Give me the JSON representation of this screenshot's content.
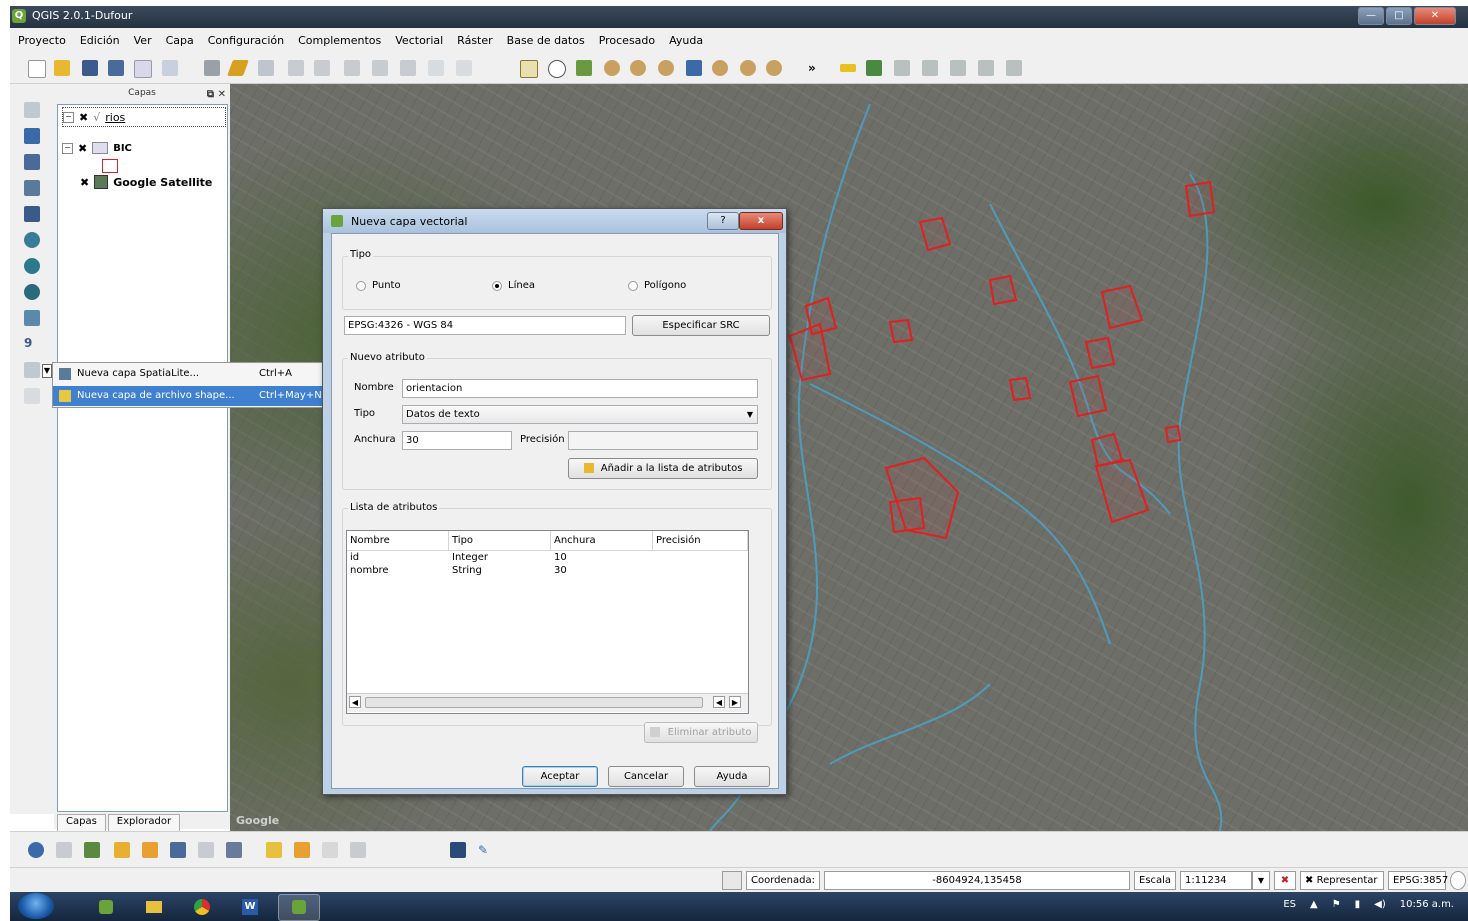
{
  "window": {
    "title": "QGIS 2.0.1-Dufour"
  },
  "menu": [
    "Proyecto",
    "Edición",
    "Ver",
    "Capa",
    "Configuración",
    "Complementos",
    "Vectorial",
    "Ráster",
    "Base de datos",
    "Procesado",
    "Ayuda"
  ],
  "layers_panel": {
    "title": "Capas",
    "layers": [
      {
        "name": "rios",
        "checked": true
      },
      {
        "name": "BIC",
        "checked": true
      },
      {
        "name": "Google Satellite",
        "checked": true
      }
    ],
    "tabs": [
      "Capas",
      "Explorador"
    ]
  },
  "context_menu": {
    "items": [
      {
        "label": "Nueva capa SpatiaLite...",
        "shortcut": "Ctrl+A",
        "highlighted": false
      },
      {
        "label": "Nueva capa de archivo shape...",
        "shortcut": "Ctrl+May+N",
        "highlighted": true
      }
    ]
  },
  "dialog": {
    "title": "Nueva capa vectorial",
    "help_btn": "?",
    "close_btn": "x",
    "tipo": {
      "title": "Tipo",
      "options": [
        {
          "label": "Punto",
          "selected": false
        },
        {
          "label": "Línea",
          "selected": true
        },
        {
          "label": "Polígono",
          "selected": false
        }
      ]
    },
    "crs_value": "EPSG:4326 - WGS 84",
    "crs_button": "Especificar SRC",
    "nuevo_atributo": {
      "title": "Nuevo atributo",
      "nombre_label": "Nombre",
      "nombre_value": "orientacion",
      "tipo_label": "Tipo",
      "tipo_value": "Datos de texto",
      "anchura_label": "Anchura",
      "anchura_value": "30",
      "precision_label": "Precisión",
      "precision_value": "",
      "add_button": "Añadir a la lista de atributos"
    },
    "lista": {
      "title": "Lista de atributos",
      "columns": [
        "Nombre",
        "Tipo",
        "Anchura",
        "Precisión"
      ],
      "rows": [
        {
          "nombre": "id",
          "tipo": "Integer",
          "anchura": "10",
          "precision": ""
        },
        {
          "nombre": "nombre",
          "tipo": "String",
          "anchura": "30",
          "precision": ""
        }
      ],
      "remove_button": "Eliminar atributo"
    },
    "buttons": {
      "ok": "Aceptar",
      "cancel": "Cancelar",
      "help": "Ayuda"
    }
  },
  "statusbar": {
    "coord_label": "Coordenada:",
    "coord_value": "-8604924,135458",
    "scale_label": "Escala",
    "scale_value": "1:11234",
    "render_label": "Representar",
    "epsg": "EPSG:3857"
  },
  "taskbar": {
    "lang": "ES",
    "time": "10:56 a.m."
  },
  "map": {
    "watermark": "Google"
  },
  "colors": {
    "accent": "#3f80d0",
    "polygon": "#e02020",
    "river": "#4aa3c8"
  }
}
